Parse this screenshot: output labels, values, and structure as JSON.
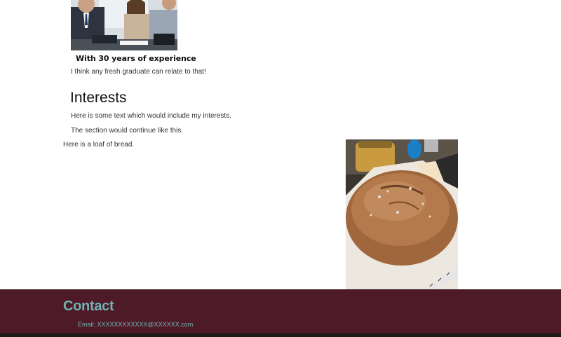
{
  "about": {
    "meme_caption": "With 30 years of experience",
    "meme_comment": "I think any fresh graduate can relate to that!"
  },
  "interests": {
    "heading": "Interests",
    "paragraphs": [
      "Here is some text which would include my interests.",
      "The section would continue like this."
    ],
    "bread_caption": "Here is a loaf of bread."
  },
  "contact": {
    "heading": "Contact",
    "email": "Email: XXXXXXXXXXXX@XXXXXX.com"
  },
  "colors": {
    "footer_background": "#4e1a28",
    "contact_text": "#6fb3b3",
    "page_background": "#ffffff"
  }
}
